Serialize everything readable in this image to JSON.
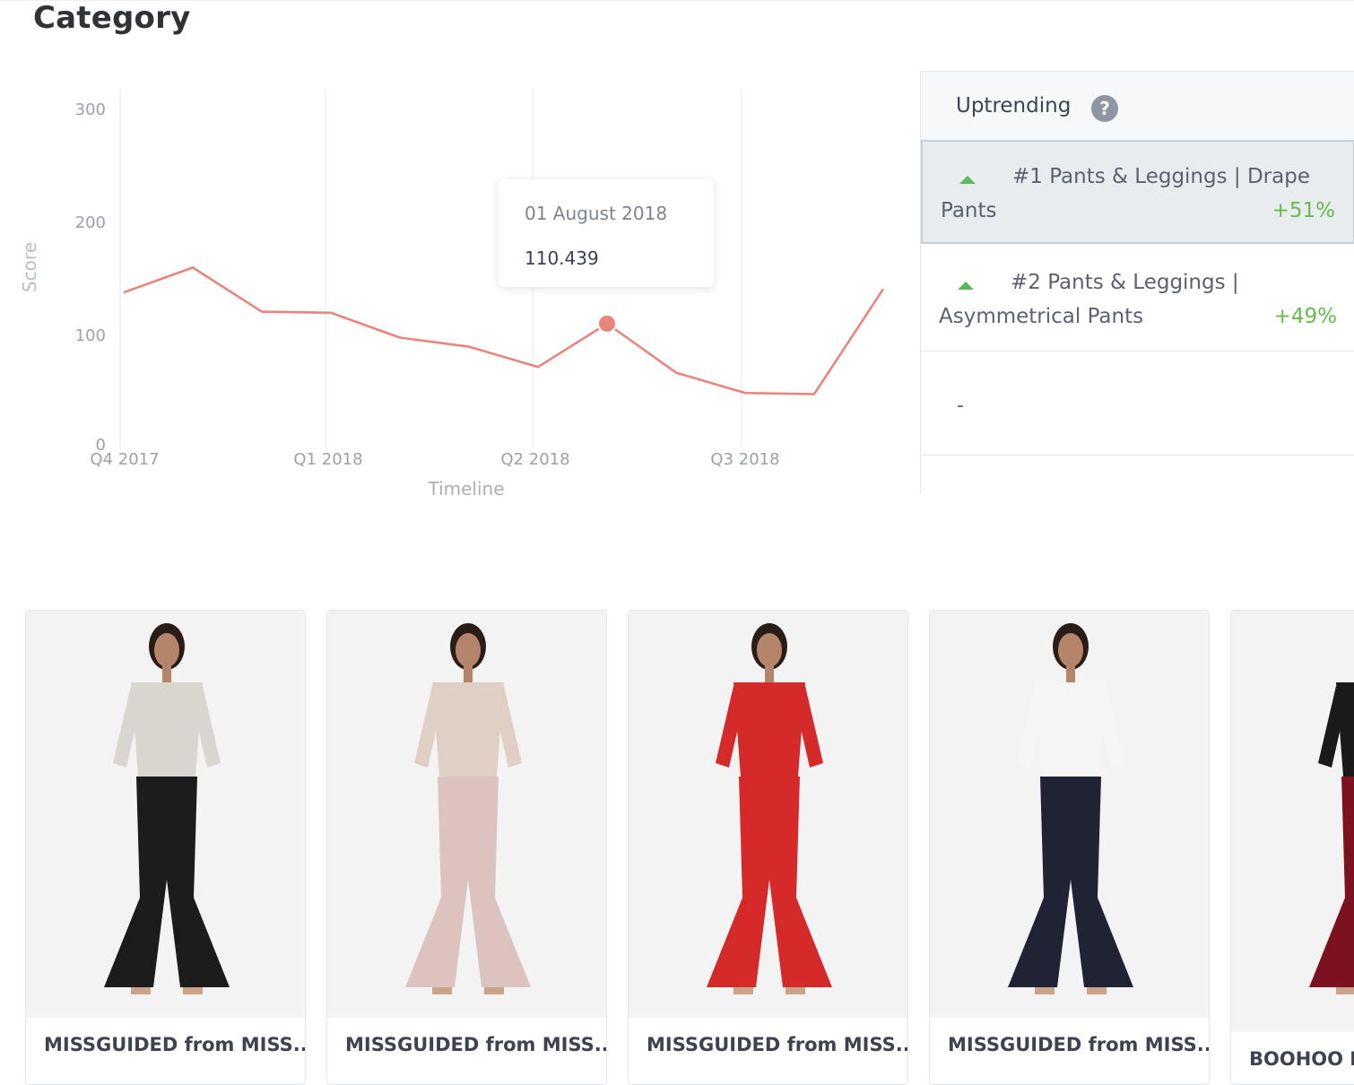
{
  "page": {
    "title": "Category"
  },
  "chart_data": {
    "type": "line",
    "ylabel": "Score",
    "xlabel": "Timeline",
    "ylim": [
      0,
      300
    ],
    "y_ticks": [
      "300",
      "200",
      "100",
      "0"
    ],
    "x_ticks": [
      "Q4 2017",
      "Q1 2018",
      "Q2 2018",
      "Q3 2018"
    ],
    "series": [
      {
        "color": "#e8857c",
        "values": [
          138,
          160,
          121,
          120,
          98,
          90,
          72,
          110.439,
          67,
          49,
          48,
          141
        ]
      }
    ],
    "highlight_index": 7,
    "tooltip": {
      "date": "01 August 2018",
      "value": "110.439"
    }
  },
  "uptrending": {
    "title": "Uptrending",
    "help_icon": "question-circle-icon",
    "items": [
      {
        "line1": "#1 Pants & Leggings | Drape",
        "line2": "Pants",
        "change": "+51%",
        "selected": true
      },
      {
        "line1": "#2 Pants & Leggings |",
        "line2": "Asymmetrical Pants",
        "change": "+49%",
        "selected": false
      },
      {
        "placeholder": "-"
      }
    ],
    "accent_up": "#5cb85c",
    "change_color": "#67bb4a"
  },
  "products": [
    {
      "caption": "MISSGUIDED from MISS...",
      "top_color": "#d9d6cf",
      "bottom_color": "#1c1c1c"
    },
    {
      "caption": "MISSGUIDED from MISS...",
      "top_color": "#e0cfc4",
      "bottom_color": "#dcc3bf"
    },
    {
      "caption": "MISSGUIDED from MISS...",
      "top_color": "#d42a2a",
      "bottom_color": "#d42a2a"
    },
    {
      "caption": "MISSGUIDED from MISS...",
      "top_color": "#f5f5f5",
      "bottom_color": "#1f2333"
    },
    {
      "caption": "BOOHOO P",
      "top_color": "#1a1a1a",
      "bottom_color": "#7c1220"
    }
  ]
}
